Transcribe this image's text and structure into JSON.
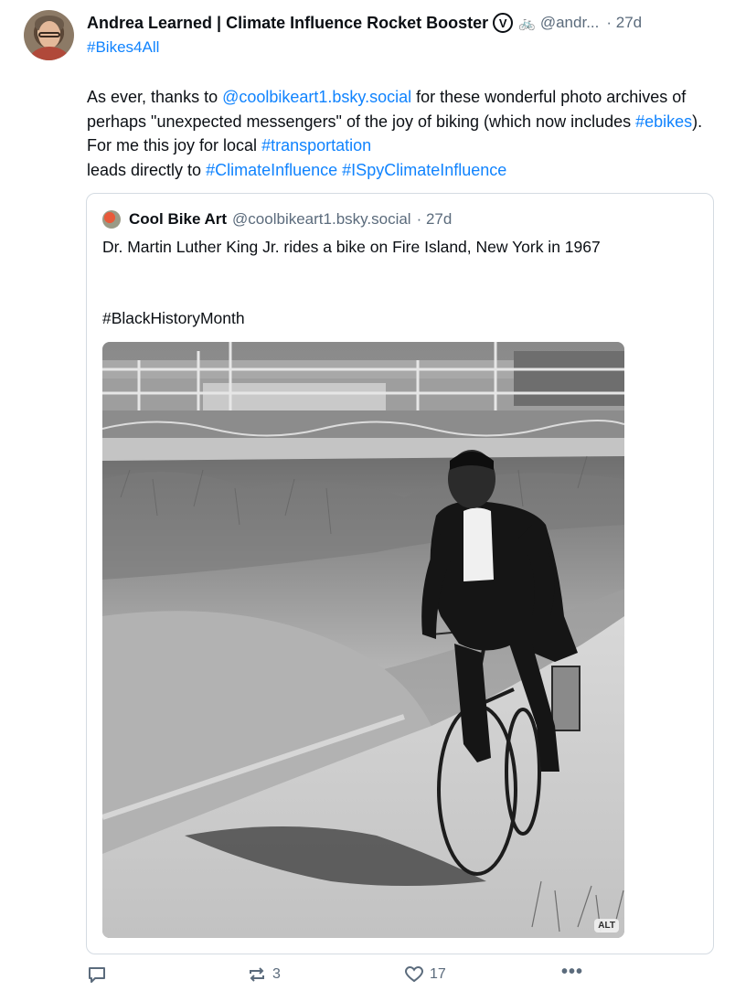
{
  "post": {
    "author": {
      "display_name": "Andrea Learned | Climate Influence Rocket Booster",
      "badge": "V",
      "emoji": "🚲",
      "handle": "@andr...",
      "time": "· 27d"
    },
    "hashtag_line": "#Bikes4All",
    "text_parts": {
      "p1": "As ever, thanks to ",
      "mention": "@coolbikeart1.bsky.social",
      "p2": " for these wonderful photo archives of perhaps \"unexpected messengers\" of the joy of biking (which now includes ",
      "tag_ebikes": "#ebikes",
      "p3": "). For me this joy for local ",
      "tag_transportation": "#transportation",
      "p4": " leads directly to ",
      "tag_climate": "#ClimateInfluence",
      "p5": " ",
      "tag_ispy": "#ISpyClimateInfluence"
    }
  },
  "quote": {
    "name": "Cool Bike Art",
    "handle": "@coolbikeart1.bsky.social",
    "time": "· 27d",
    "text": "Dr. Martin Luther King Jr. rides a bike on Fire Island, New York in 1967",
    "tag": "#BlackHistoryMonth",
    "alt_label": "ALT"
  },
  "actions": {
    "repost_count": "3",
    "like_count": "17",
    "more_label": "•••"
  },
  "icons": {
    "reply": "reply-bubble-icon",
    "repost": "repost-arrows-icon",
    "like": "heart-icon",
    "more": "more-dots-icon"
  },
  "colors": {
    "link": "#1083fe",
    "muted": "#5b6b7c",
    "border": "#d4dbe2"
  }
}
